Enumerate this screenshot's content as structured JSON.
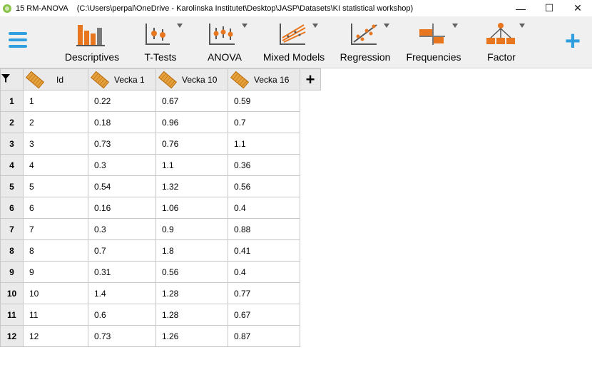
{
  "window": {
    "title": "15 RM-ANOVA",
    "path": "(C:\\Users\\perpal\\OneDrive - Karolinska Institutet\\Desktop\\JASP\\Datasets\\KI statistical workshop)",
    "minimize": "—",
    "maximize": "☐",
    "close": "✕"
  },
  "ribbon": {
    "menu_icon": "hamburger-icon",
    "buttons": [
      {
        "label": "Descriptives",
        "icon": "bar-chart-icon"
      },
      {
        "label": "T-Tests",
        "icon": "t-test-icon"
      },
      {
        "label": "ANOVA",
        "icon": "anova-icon"
      },
      {
        "label": "Mixed Models",
        "icon": "mixed-models-icon"
      },
      {
        "label": "Regression",
        "icon": "regression-icon"
      },
      {
        "label": "Frequencies",
        "icon": "frequencies-icon"
      },
      {
        "label": "Factor",
        "icon": "factor-icon"
      }
    ],
    "add_label": "+"
  },
  "table": {
    "columns": [
      "Id",
      "Vecka 1",
      "Vecka 10",
      "Vecka 16"
    ],
    "add_column": "+",
    "rows": [
      {
        "n": "1",
        "cells": [
          "1",
          "0.22",
          "0.67",
          "0.59"
        ]
      },
      {
        "n": "2",
        "cells": [
          "2",
          "0.18",
          "0.96",
          "0.7"
        ]
      },
      {
        "n": "3",
        "cells": [
          "3",
          "0.73",
          "0.76",
          "1.1"
        ]
      },
      {
        "n": "4",
        "cells": [
          "4",
          "0.3",
          "1.1",
          "0.36"
        ]
      },
      {
        "n": "5",
        "cells": [
          "5",
          "0.54",
          "1.32",
          "0.56"
        ]
      },
      {
        "n": "6",
        "cells": [
          "6",
          "0.16",
          "1.06",
          "0.4"
        ]
      },
      {
        "n": "7",
        "cells": [
          "7",
          "0.3",
          "0.9",
          "0.88"
        ]
      },
      {
        "n": "8",
        "cells": [
          "8",
          "0.7",
          "1.8",
          "0.41"
        ]
      },
      {
        "n": "9",
        "cells": [
          "9",
          "0.31",
          "0.56",
          "0.4"
        ]
      },
      {
        "n": "10",
        "cells": [
          "10",
          "1.4",
          "1.28",
          "0.77"
        ]
      },
      {
        "n": "11",
        "cells": [
          "11",
          "0.6",
          "1.28",
          "0.67"
        ]
      },
      {
        "n": "12",
        "cells": [
          "12",
          "0.73",
          "1.26",
          "0.87"
        ]
      }
    ]
  },
  "colors": {
    "accent": "#2f9fe0",
    "icon_orange": "#e8761f",
    "icon_grey": "#7a7a7a"
  }
}
